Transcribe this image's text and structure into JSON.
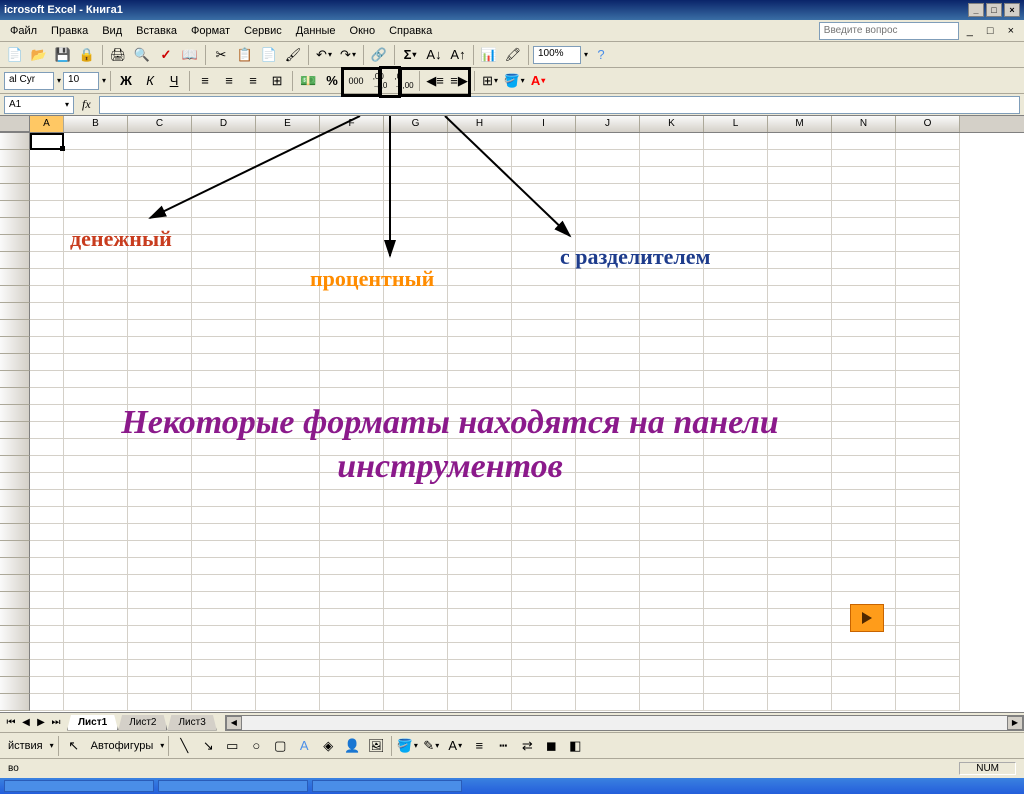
{
  "title": "icrosoft Excel - Книга1",
  "menus": [
    "Файл",
    "Правка",
    "Вид",
    "Вставка",
    "Формат",
    "Сервис",
    "Данные",
    "Окно",
    "Справка"
  ],
  "question_placeholder": "Введите вопрос",
  "toolbar1": {
    "zoom": "100%"
  },
  "toolbar2": {
    "font_name": "al Cyr",
    "font_size": "10",
    "percent": "%",
    "comma": "000",
    "inc_dec": ",00",
    "dec_inc": ",0"
  },
  "namebox": "A1",
  "columns": [
    "A",
    "B",
    "C",
    "D",
    "E",
    "F",
    "G",
    "H",
    "I",
    "J",
    "K",
    "L",
    "M",
    "N",
    "O"
  ],
  "rows": 34,
  "annotations": {
    "currency": "денежный",
    "percent": "процентный",
    "separator": "с разделителем"
  },
  "main_text": "Некоторые форматы находятся на панели инструментов",
  "sheets": [
    "Лист1",
    "Лист2",
    "Лист3"
  ],
  "draw": {
    "actions": "йствия",
    "autoshapes": "Автофигуры"
  },
  "status": {
    "ready": "во",
    "num": "NUM"
  }
}
